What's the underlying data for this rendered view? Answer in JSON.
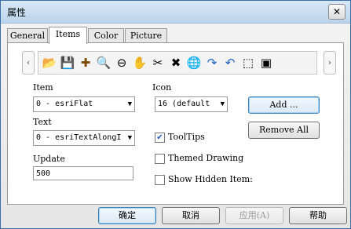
{
  "window": {
    "title": "属性",
    "close_glyph": "✕"
  },
  "tabs": [
    {
      "label": "General"
    },
    {
      "label": "Items"
    },
    {
      "label": "Color"
    },
    {
      "label": "Picture"
    }
  ],
  "toolbar": {
    "left_arrow": "‹",
    "right_arrow": "›",
    "icons": [
      {
        "name": "open-folder-icon",
        "glyph": "📂"
      },
      {
        "name": "save-icon",
        "glyph": "💾"
      },
      {
        "name": "add-icon",
        "glyph": "✚"
      },
      {
        "name": "zoom-in-icon",
        "glyph": "🔍"
      },
      {
        "name": "zoom-out-icon",
        "glyph": "⊖"
      },
      {
        "name": "pan-icon",
        "glyph": "✋"
      },
      {
        "name": "cut-icon",
        "glyph": "✂"
      },
      {
        "name": "delete-icon",
        "glyph": "✖"
      },
      {
        "name": "globe-icon",
        "glyph": "🌐"
      },
      {
        "name": "redo-icon",
        "glyph": "↷"
      },
      {
        "name": "undo-icon",
        "glyph": "↶"
      },
      {
        "name": "select-icon",
        "glyph": "⬚"
      },
      {
        "name": "properties-icon",
        "glyph": "▣"
      }
    ]
  },
  "fields": {
    "item_label": "Item",
    "item_value": "0 - esriFlat",
    "icon_label": "Icon",
    "icon_value": "16  (default",
    "text_label": "Text",
    "text_value": "0 - esriTextAlongI",
    "update_label": "Update",
    "update_value": "500",
    "dropdown_arrow": "▼"
  },
  "buttons": {
    "add": "Add ...",
    "remove_all": "Remove  All"
  },
  "checkboxes": [
    {
      "label": "ToolTips",
      "checked": true,
      "mark": "✔"
    },
    {
      "label": "Themed Drawing",
      "checked": false,
      "mark": ""
    },
    {
      "label": "Show Hidden Item:",
      "checked": false,
      "mark": ""
    }
  ],
  "footer": {
    "ok": "确定",
    "cancel": "取消",
    "apply": "应用(A)",
    "help": "帮助"
  }
}
